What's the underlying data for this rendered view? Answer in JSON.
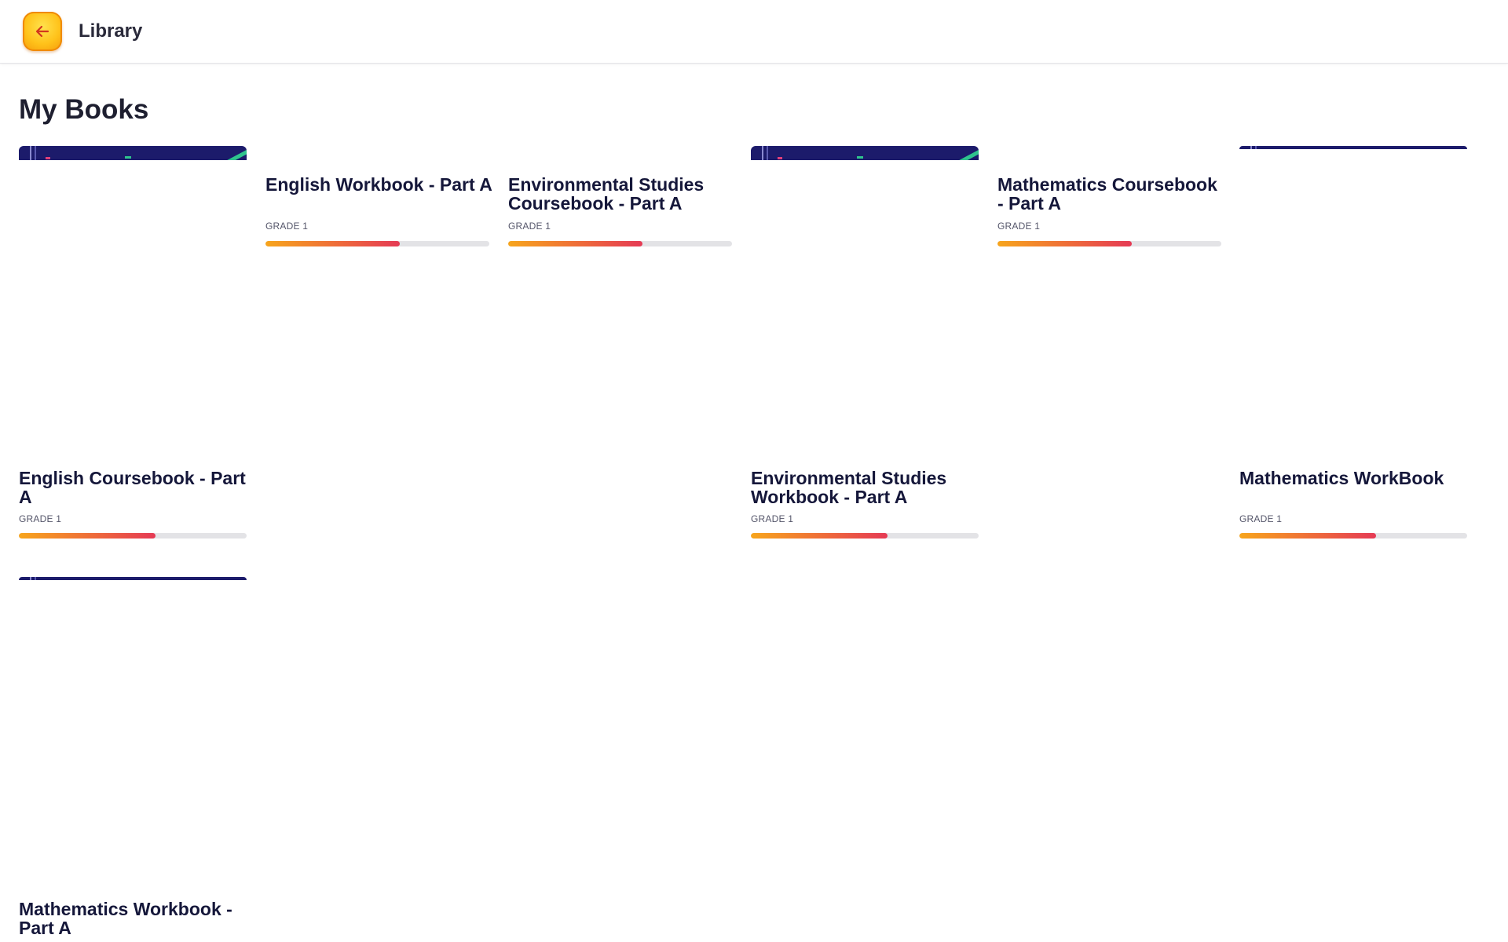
{
  "header": {
    "back_icon": "arrow-left-icon",
    "title": "Library"
  },
  "page": {
    "title": "My Books"
  },
  "books": [
    {
      "title_line1": "",
      "title_line2": "",
      "full_title": "English Workbook - Part A",
      "grade": "GRADE 1",
      "progress": 0.6
    },
    {
      "full_title": "Environmental Studies Coursebook - Part A",
      "grade": "GRADE 1",
      "progress": 0.6
    },
    {
      "full_title": "Mathematics Coursebook - Part A",
      "grade": "GRADE 1",
      "progress": 0.6
    },
    {
      "full_title": "English Coursebook - Part A",
      "grade": "GRADE 1",
      "progress": 0.6
    },
    {
      "full_title": "Environmental Studies Workbook - Part A",
      "grade": "GRADE 1",
      "progress": 0.6
    },
    {
      "full_title": "Mathematics WorkBook",
      "grade": "GRADE 1",
      "progress": 0.6
    },
    {
      "full_title": "Mathematics Workbook - Part A"
    }
  ],
  "colors": {
    "accent_yellow": "#ffc21a",
    "progress_start": "#f7a51c",
    "progress_end": "#e53a55",
    "cover_navy": "#1c1b6b"
  }
}
